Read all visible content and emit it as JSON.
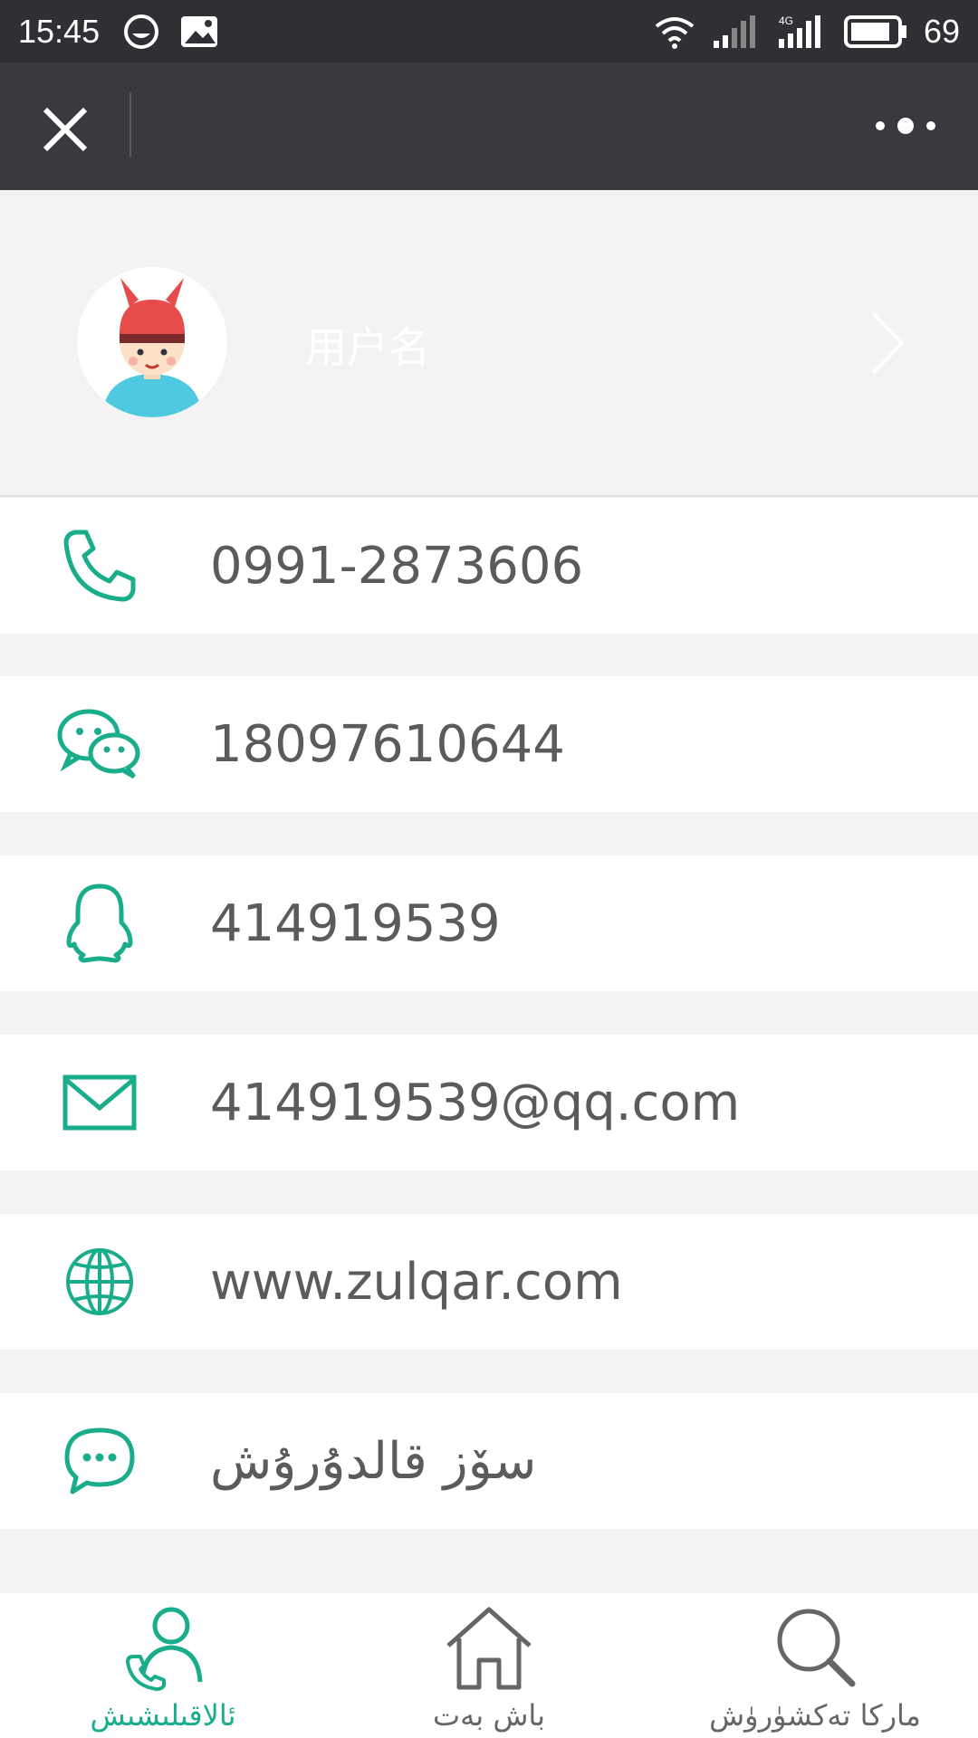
{
  "status_bar": {
    "time": "15:45",
    "battery": "69",
    "network": "4G"
  },
  "title_bar": {
    "close_icon": "close-icon",
    "more_icon": "more-icon"
  },
  "profile": {
    "username": "用户名"
  },
  "contacts": [
    {
      "icon": "phone-icon",
      "value": "0991-2873606"
    },
    {
      "icon": "wechat-icon",
      "value": "18097610644"
    },
    {
      "icon": "qq-icon",
      "value": "414919539"
    },
    {
      "icon": "mail-icon",
      "value": "414919539@qq.com"
    },
    {
      "icon": "globe-icon",
      "value": "www.zulqar.com"
    },
    {
      "icon": "message-icon",
      "value": "سۆز قالدۇرۇش"
    }
  ],
  "bottom_nav": [
    {
      "icon": "contact-icon",
      "label": "ئالاقىلىشىش",
      "active": true
    },
    {
      "icon": "home-icon",
      "label": "باش بەت",
      "active": false
    },
    {
      "icon": "search-icon",
      "label": "ماركا تەكشۈرۈش",
      "active": false
    }
  ],
  "colors": {
    "accent": "#1aad8c",
    "title_bar": "#393a3f",
    "status_bar": "#2f3033",
    "background": "#f3f3f3"
  }
}
